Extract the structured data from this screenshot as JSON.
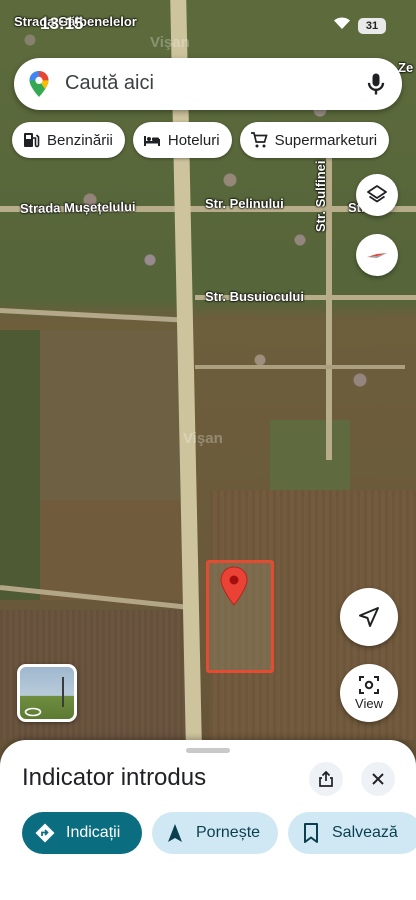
{
  "status_bar": {
    "time": "13:15",
    "battery": "31"
  },
  "map": {
    "street_labels": {
      "gaibenelelor": "Strada Gălbenelelor",
      "musetelului": "Strada Mușețelului",
      "pelinului": "Str. Pelinului",
      "sulfinei": "Str. Sulfinei",
      "busuiocului": "Str. Busuiocului",
      "partial_right": "Str",
      "partial_ze": "Ze"
    },
    "watermark": "Vişan"
  },
  "search": {
    "placeholder": "Caută aici"
  },
  "chips": [
    {
      "label": "Benzinării",
      "icon": "gas-station-icon"
    },
    {
      "label": "Hoteluri",
      "icon": "bed-icon"
    },
    {
      "label": "Supermarketuri",
      "icon": "shopping-cart-icon"
    }
  ],
  "map_controls": {
    "view_label": "View"
  },
  "sheet": {
    "title": "Indicator introdus",
    "actions": {
      "directions": "Indicații",
      "start": "Pornește",
      "save": "Salvează"
    }
  },
  "colors": {
    "accent": "#0b6e80",
    "secondary_button": "#cfe8f4",
    "plot_outline": "#e44b30",
    "pin": "#ea4335"
  }
}
